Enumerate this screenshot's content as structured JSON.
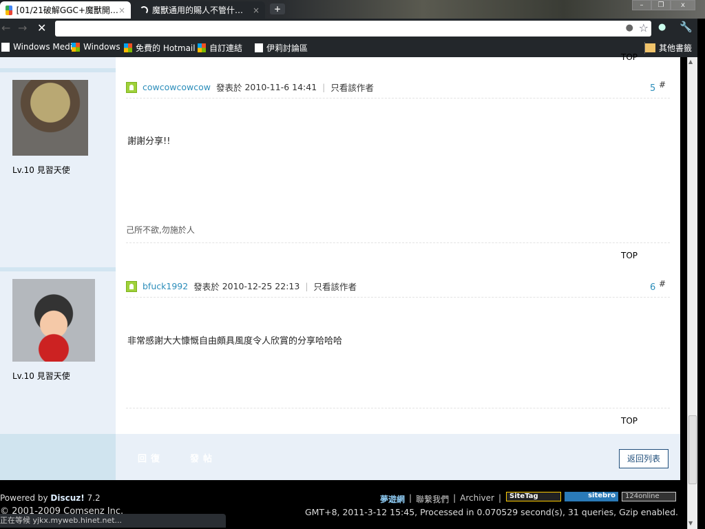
{
  "browser": {
    "tabs": [
      {
        "title": "[01/21破解GGC+魔獸開…"
      },
      {
        "title": "魔獸通用的賜人不管什…"
      }
    ],
    "new_tab": "+",
    "window_controls": {
      "minimize": "–",
      "restore": "❐",
      "close": "x"
    },
    "bookmarks": [
      {
        "label": "Windows Media"
      },
      {
        "label": "Windows"
      },
      {
        "label": "免費的 Hotmail"
      },
      {
        "label": "自訂連結"
      },
      {
        "label": "伊莉討論區"
      }
    ],
    "other_bookmarks": "其他書籤",
    "status": "正在等候 yjkx.myweb.hinet.net..."
  },
  "posts": [
    {
      "author": "cowcowcowcow",
      "posted_label": "發表於",
      "date": "2010-11-6 14:41",
      "only_author": "只看該作者",
      "floor": "5",
      "hash": "#",
      "content": "謝謝分享!!",
      "signature": "己所不欲,勿施於人",
      "level": "Lv.10 見習天使",
      "top": "TOP"
    },
    {
      "author": "bfuck1992",
      "posted_label": "發表於",
      "date": "2010-12-25 22:13",
      "only_author": "只看該作者",
      "floor": "6",
      "hash": "#",
      "content": "非常感謝大大慷慨自由頗具風度令人欣賞的分享哈哈哈",
      "level": "Lv.10 見習天使",
      "top": "TOP"
    }
  ],
  "prev_top": "TOP",
  "actions": {
    "reply": "回復",
    "new_post": "發帖",
    "back_to_list": "返回列表"
  },
  "footer": {
    "powered_by": "Powered by",
    "discuz": "Discuz!",
    "version": "7.2",
    "copyright": "© 2001-2009 Comsenz Inc.",
    "site_name": "夢遊網",
    "contact": "聯繫我們",
    "archiver": "Archiver",
    "badges": [
      "SiteTag",
      "sitebro",
      "124online"
    ],
    "stats": "GMT+8, 2011-3-12 15:45, Processed in 0.070529 second(s), 31 queries, Gzip enabled."
  }
}
